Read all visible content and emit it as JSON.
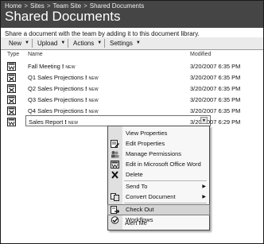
{
  "breadcrumb": [
    "Home",
    "Sites",
    "Team Site",
    "Shared Documents"
  ],
  "breadcrumb_separator": ">",
  "page_title": "Shared Documents",
  "description": "Share a document with the team by adding it to this document library.",
  "toolbar": {
    "new_label": "New",
    "upload_label": "Upload",
    "actions_label": "Actions",
    "settings_label": "Settings"
  },
  "columns": {
    "type": "Type",
    "name": "Name",
    "modified": "Modified"
  },
  "new_tag": "NEW",
  "documents": [
    {
      "name": "Fall Meeting",
      "modified": "3/20/2007 6:35 PM"
    },
    {
      "name": "Q1 Sales Projections",
      "modified": "3/20/2007 6:35 PM"
    },
    {
      "name": "Q2 Sales Projections",
      "modified": "3/20/2007 6:35 PM"
    },
    {
      "name": "Q3 Sales Projections",
      "modified": "3/20/2007 6:35 PM"
    },
    {
      "name": "Q4 Sales Projections",
      "modified": "3/20/2007 6:35 PM"
    },
    {
      "name": "Sales Report",
      "modified": "3/20/2007 6:29 PM"
    }
  ],
  "context_menu": {
    "items": [
      {
        "label": "View Properties",
        "icon": "none"
      },
      {
        "label": "Edit Properties",
        "icon": "edit-properties-icon"
      },
      {
        "label": "Manage Permissions",
        "icon": "manage-permissions-icon"
      },
      {
        "label": "Edit in Microsoft Office Word",
        "icon": "word-icon"
      },
      {
        "label": "Delete",
        "icon": "delete-icon"
      },
      {
        "label": "Send To",
        "icon": "none",
        "submenu": true
      },
      {
        "label": "Convert Document",
        "icon": "convert-document-icon",
        "submenu": true
      },
      {
        "label": "Check Out",
        "icon": "check-out-icon",
        "highlighted": true
      },
      {
        "label": "Workflows",
        "icon": "workflows-icon"
      },
      {
        "label": "Alert Me",
        "icon": "none"
      }
    ]
  },
  "colors": {
    "header": "#454545",
    "toolbar": "#ebebeb",
    "menu_highlight": "#d4d4d4"
  }
}
